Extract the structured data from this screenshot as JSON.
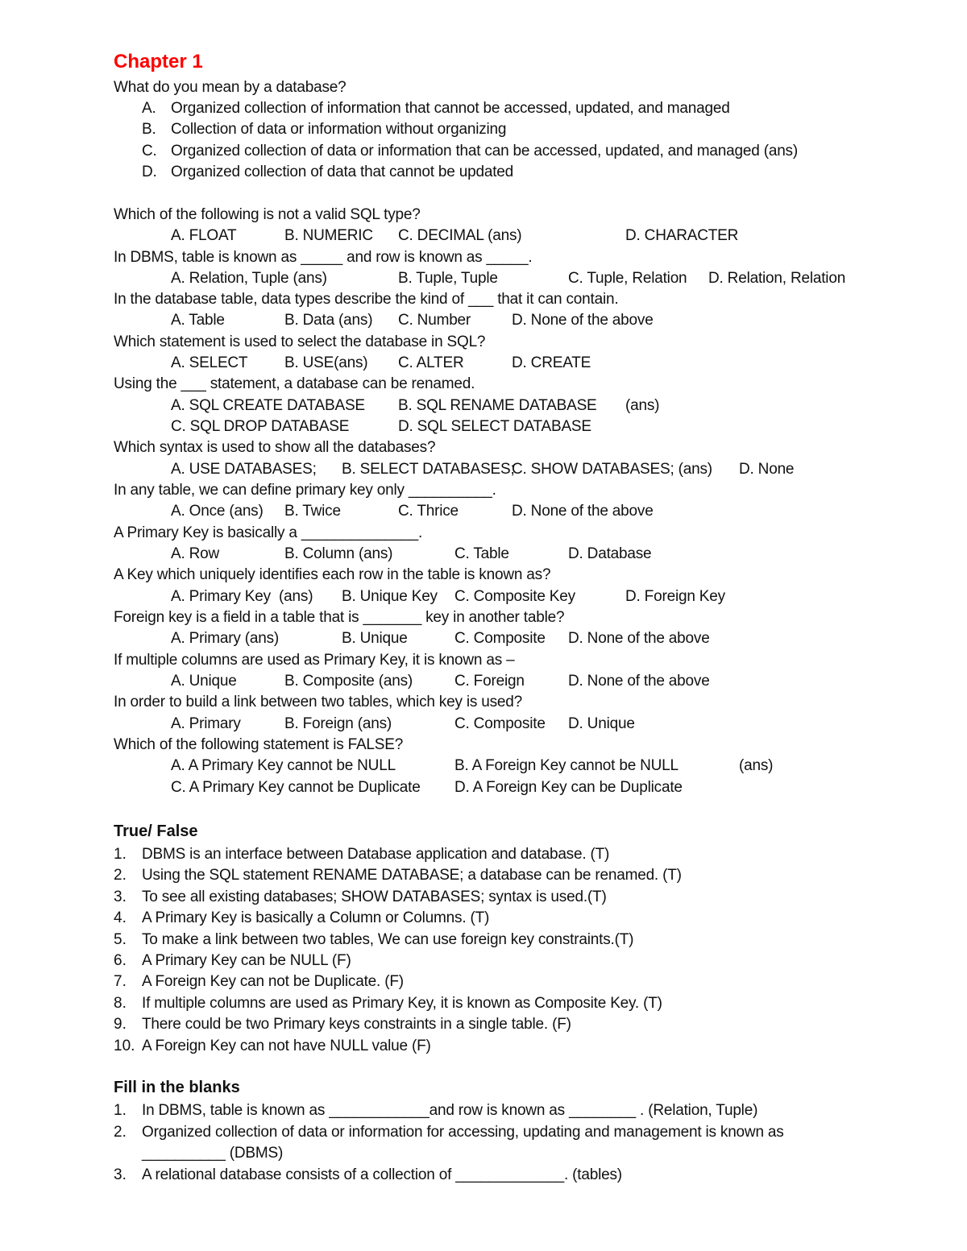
{
  "chapter_title": "Chapter 1",
  "mcq": [
    {
      "q": "What do you mean by a database?",
      "options": [
        "A.",
        "Organized collection of information that cannot be accessed, updated, and managed",
        "B.",
        "Collection of data or information without organizing",
        "C.",
        "Organized collection of data or information that can be accessed, updated, and managed (ans)",
        "D.",
        "Organized collection of data that cannot be updated"
      ]
    },
    {
      "q": "Which of the following is not a valid SQL type?",
      "options": [
        "A. FLOAT",
        "B. NUMERIC",
        "C. DECIMAL (ans)",
        "D. CHARACTER"
      ]
    },
    {
      "q": "In DBMS, table is known as _____ and row is known as _____.",
      "options": [
        "A. Relation, Tuple (ans)",
        "B. Tuple, Tuple",
        "C. Tuple, Relation",
        "D. Relation, Relation"
      ]
    },
    {
      "q": "In the database table, data types describe the kind of ___ that it can contain.",
      "options": [
        "A. Table",
        "B. Data (ans)",
        "C. Number",
        "D. None of the above"
      ]
    },
    {
      "q": "Which statement is used to select the database in SQL?",
      "options": [
        "A. SELECT",
        "B. USE(ans)",
        "C. ALTER",
        "D. CREATE"
      ]
    },
    {
      "q": "Using the ___ statement, a database can be renamed.",
      "options": [
        "A. SQL CREATE DATABASE",
        "B. SQL RENAME DATABASE",
        "(ans)",
        "C. SQL DROP DATABASE",
        "D. SQL SELECT DATABASE"
      ]
    },
    {
      "q": "Which syntax is used to show all the databases?",
      "options": [
        "A. USE DATABASES;",
        "B. SELECT DATABASES;",
        "C. SHOW DATABASES; (ans)",
        "D. None"
      ]
    },
    {
      "q": "In any table, we can define primary key only __________.",
      "options": [
        "A. Once (ans)",
        "B. Twice",
        "C. Thrice",
        "D. None of the above"
      ]
    },
    {
      "q": "A Primary Key is basically a ______________.",
      "options": [
        "A. Row",
        "B. Column (ans)",
        "C. Table",
        "D. Database"
      ]
    },
    {
      "q": "A Key which uniquely identifies each row in the table is known as?",
      "options": [
        "A. Primary Key  (ans)",
        "B. Unique Key",
        "C. Composite Key",
        "D. Foreign Key"
      ]
    },
    {
      "q": "Foreign key is a field in a table that is _______ key in another table?",
      "options": [
        "A. Primary (ans)",
        "B. Unique",
        "C. Composite",
        "D. None of the above"
      ]
    },
    {
      "q": "If multiple columns are used as Primary Key, it is known as –",
      "options": [
        "A. Unique",
        "B. Composite (ans)",
        "C. Foreign",
        "D. None of the above"
      ]
    },
    {
      "q": "In order to build a link between two tables, which key is used?",
      "options": [
        "A. Primary",
        "B. Foreign (ans)",
        "C. Composite",
        "D. Unique"
      ]
    },
    {
      "q": "Which of the following statement is FALSE?",
      "options": [
        "A. A Primary Key cannot be NULL",
        "B. A Foreign Key cannot be NULL",
        "(ans)",
        "C. A Primary Key cannot be Duplicate",
        "D. A Foreign Key can be Duplicate"
      ]
    }
  ],
  "true_false": {
    "heading": "True/ False",
    "items": [
      {
        "n": "1.",
        "text": "DBMS is an interface between Database application and database. (T)"
      },
      {
        "n": "2.",
        "text": "Using the SQL statement RENAME DATABASE; a database can be renamed. (T)"
      },
      {
        "n": "3.",
        "text": "To see all existing databases; SHOW DATABASES; syntax is used.(T)"
      },
      {
        "n": "4.",
        "text": "A Primary Key is basically a Column or Columns. (T)"
      },
      {
        "n": "5.",
        "text": "To make a link between two tables, We can use foreign key constraints.(T)"
      },
      {
        "n": "6.",
        "text": "A Primary Key can be NULL (F)"
      },
      {
        "n": "7.",
        "text": "A Foreign Key can not be Duplicate. (F)"
      },
      {
        "n": "8.",
        "text": "If multiple columns are used as Primary Key, it is known as Composite Key. (T)"
      },
      {
        "n": "9.",
        "text": "There could be two Primary keys constraints in a single table. (F)"
      },
      {
        "n": "10.",
        "text": "A Foreign Key can not have NULL value (F)"
      }
    ]
  },
  "fill_blanks": {
    "heading": "Fill in the blanks",
    "items": [
      {
        "n": "1.",
        "text": "In DBMS, table is known as ____________and row is known as ________ . (Relation, Tuple)"
      },
      {
        "n": "2.",
        "text": "Organized collection of data or information for accessing, updating and management is known as",
        "text2": "__________ (DBMS)"
      },
      {
        "n": "3.",
        "text": "A relational database consists of a collection of _____________. (tables)"
      }
    ]
  }
}
